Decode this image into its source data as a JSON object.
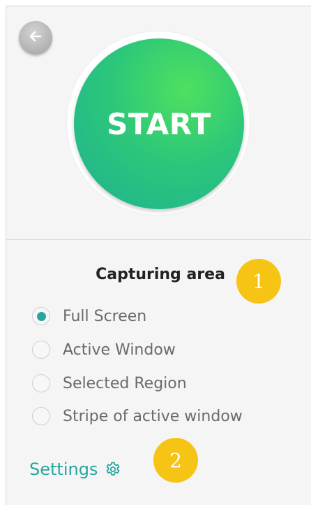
{
  "colors": {
    "accent": "#27a6a0",
    "start_gradient": [
      "#4fe05f",
      "#1fb191"
    ],
    "badge": "#f6c415",
    "panel_bg": "#f5f5f5"
  },
  "header": {
    "back_icon": "arrow-left-icon"
  },
  "start_button": {
    "label": "START"
  },
  "capturing_area": {
    "title": "Capturing area",
    "selected": "Full Screen",
    "options": [
      {
        "label": "Full Screen",
        "checked": true
      },
      {
        "label": "Active Window",
        "checked": false
      },
      {
        "label": "Selected Region",
        "checked": false
      },
      {
        "label": "Stripe of active window",
        "checked": false
      }
    ]
  },
  "settings": {
    "label": "Settings",
    "icon": "gear-icon"
  },
  "annotations": [
    {
      "number": "1"
    },
    {
      "number": "2"
    }
  ]
}
